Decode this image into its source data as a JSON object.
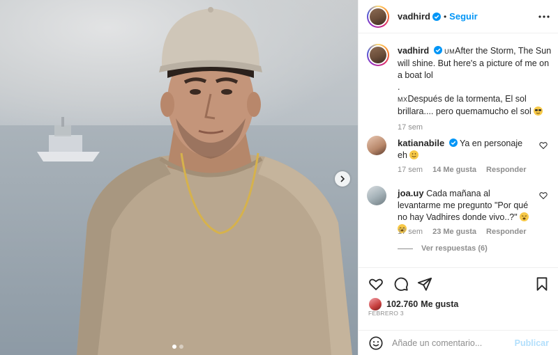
{
  "post": {
    "username": "vadhird",
    "follow_label": "Seguir",
    "separator": "•",
    "caption": {
      "flag1": "UM",
      "line1": "After the Storm, The Sun will shine. But here's a picture of me on a boat lol",
      "dot": ".",
      "flag2": "MX",
      "line2": "Después de la tormenta, El sol brillara.... pero quemamucho el sol",
      "emoji": "sunglasses-emoji",
      "time": "17 sem"
    },
    "carousel": {
      "current": 1,
      "total": 2
    }
  },
  "comments": [
    {
      "username": "katianabile",
      "verified": true,
      "text": "Ya en personaje eh",
      "emoji": "smile-emoji",
      "time": "17 sem",
      "likes": "14 Me gusta",
      "reply": "Responder"
    },
    {
      "username": "joa.uy",
      "verified": false,
      "text": "Cada mañana al levantarme me pregunto \"Por qué no hay Vadhires donde vivo..?\"",
      "emoji": "crying-emoji",
      "time": "17 sem",
      "likes": "23 Me gusta",
      "reply": "Responder"
    }
  ],
  "view_replies": "Ver respuestas (6)",
  "likes": {
    "count": "102.760",
    "label": "Me gusta"
  },
  "date": "FEBRERO 3",
  "add_comment": {
    "placeholder": "Añade un comentario...",
    "publish": "Publicar"
  },
  "icons": {
    "like": "heart-icon",
    "comment": "comment-icon",
    "share": "paper-plane-icon",
    "save": "bookmark-icon",
    "more": "more-options-icon",
    "next": "chevron-right-icon",
    "emoji": "emoji-icon"
  },
  "colors": {
    "accent": "#0095f6",
    "text": "#262626",
    "muted": "#8e8e8e",
    "publish_disabled": "#b2dffc"
  }
}
